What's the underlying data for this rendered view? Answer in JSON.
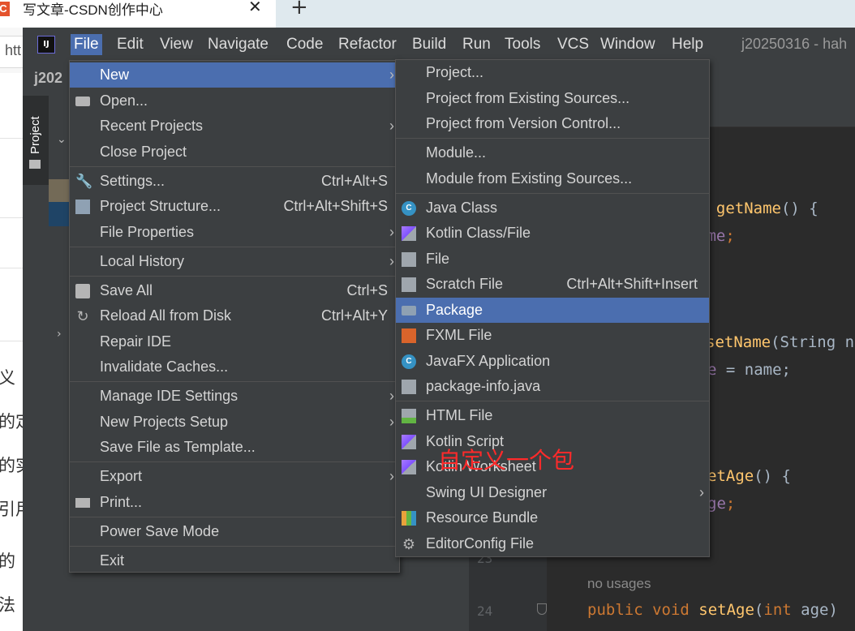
{
  "browser": {
    "tab_title": "写文章-CSDN创作中心",
    "tab_close": "✕",
    "new_tab": "+",
    "url_partial": "htt",
    "favicon": "C"
  },
  "background_page": {
    "chars": [
      "义",
      "的定",
      "的实",
      "引用",
      "的",
      "法"
    ]
  },
  "ide": {
    "logo": "IJ",
    "menu": [
      "File",
      "Edit",
      "View",
      "Navigate",
      "Code",
      "Refactor",
      "Build",
      "Run",
      "Tools",
      "VCS",
      "Window",
      "Help"
    ],
    "title": "j20250316 - hah",
    "project_crumb": "j202",
    "project_tab": "Project"
  },
  "file_menu": {
    "new": "New",
    "open": "Open...",
    "recent_projects": "Recent Projects",
    "close_project": "Close Project",
    "settings": "Settings...",
    "settings_sc": "Ctrl+Alt+S",
    "project_structure": "Project Structure...",
    "project_structure_sc": "Ctrl+Alt+Shift+S",
    "file_properties": "File Properties",
    "local_history": "Local History",
    "save_all": "Save All",
    "save_all_sc": "Ctrl+S",
    "reload": "Reload All from Disk",
    "reload_sc": "Ctrl+Alt+Y",
    "repair_ide": "Repair IDE",
    "invalidate_caches": "Invalidate Caches...",
    "manage_ide_settings": "Manage IDE Settings",
    "new_projects_setup": "New Projects Setup",
    "save_as_template": "Save File as Template...",
    "export": "Export",
    "print": "Print...",
    "power_save": "Power Save Mode",
    "exit": "Exit"
  },
  "new_menu": {
    "project": "Project...",
    "project_existing": "Project from Existing Sources...",
    "project_vcs": "Project from Version Control...",
    "module": "Module...",
    "module_existing": "Module from Existing Sources...",
    "java_class": "Java Class",
    "kotlin_class": "Kotlin Class/File",
    "file": "File",
    "scratch_file": "Scratch File",
    "scratch_sc": "Ctrl+Alt+Shift+Insert",
    "package": "Package",
    "fxml": "FXML File",
    "javafx": "JavaFX Application",
    "package_info": "package-info.java",
    "html": "HTML File",
    "kotlin_script": "Kotlin Script",
    "kotlin_worksheet": "Kotlin Worksheet",
    "swing": "Swing UI Designer",
    "resource_bundle": "Resource Bundle",
    "editorconfig": "EditorConfig File"
  },
  "annotation": "自定义一个包",
  "editor": {
    "line1_type": "g ",
    "line1_fn": "getName",
    "line1_rest": "() {",
    "line2_field": "ame",
    "line2_rest": ";",
    "line3_fn": "setName",
    "line3_rest": "(String n",
    "line4_field": "e",
    "line4_rest": " = name;",
    "line5_fn": "etAge",
    "line5_rest": "() {",
    "line6_field": "ge",
    "line6_rest": ";",
    "hint": "no usages",
    "line_no_23": "23",
    "line_no_24": "24",
    "line7_kw": "public void ",
    "line7_fn": "setAge",
    "line7_paren": "(",
    "line7_kw2": "int",
    "line7_rest": " age)"
  }
}
